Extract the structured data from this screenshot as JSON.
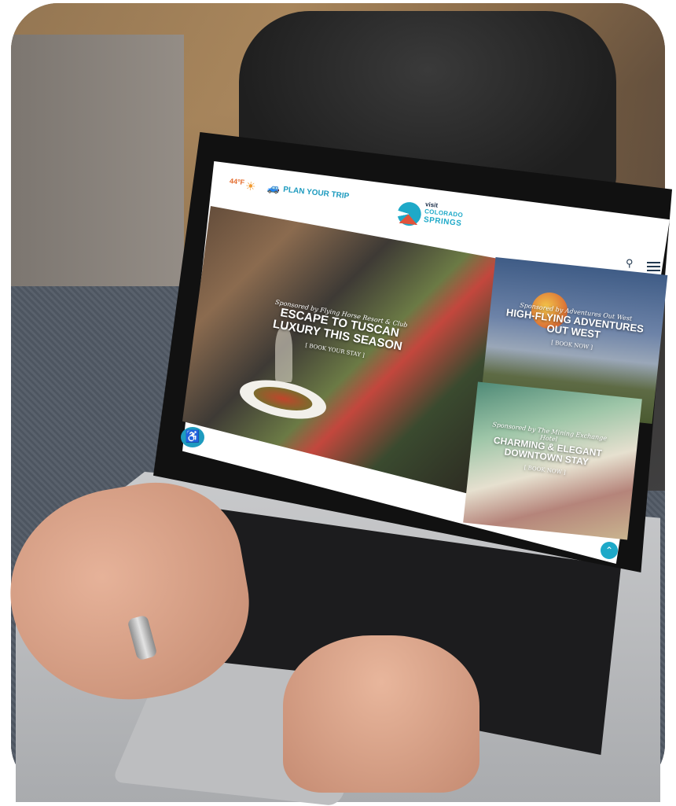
{
  "site": {
    "temperature": "44°F",
    "weather_icon": "sun-icon",
    "plan_trip_label": "PLAN YOUR TRIP",
    "logo": {
      "line1": "visit",
      "line2": "COLORADO",
      "line3": "SPRINGS"
    }
  },
  "tiles": [
    {
      "sponsor": "Sponsored by Flying Horse Resort & Club",
      "title": "ESCAPE TO TUSCAN LUXURY THIS SEASON",
      "cta": "[ BOOK YOUR STAY ]"
    },
    {
      "sponsor": "Sponsored by Adventures Out West",
      "title": "HIGH-FLYING ADVENTURES OUT WEST",
      "cta": "[ BOOK NOW ]"
    },
    {
      "sponsor": "Sponsored by The Mining Exchange Hotel",
      "title": "CHARMING & ELEGANT DOWNTOWN STAY",
      "cta": "[ BOOK NOW ]"
    }
  ],
  "colors": {
    "accent": "#1ea9c8",
    "weather": "#e46a2a",
    "navy": "#22384f"
  }
}
